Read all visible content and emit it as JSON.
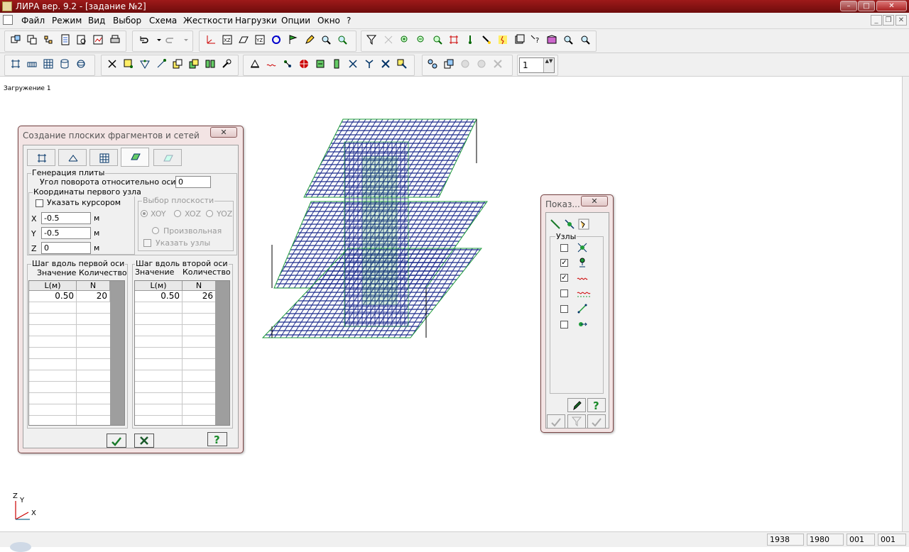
{
  "window": {
    "title": "ЛИРА  вер. 9.2 - [задание №2]",
    "min": "–",
    "max": "□",
    "close": "✕"
  },
  "menu": {
    "items": [
      "Файл",
      "Режим",
      "Вид",
      "Выбор",
      "Схема",
      "Жесткости",
      "Нагрузки",
      "Опции",
      "Окно",
      "?"
    ],
    "mdi_min": "_",
    "mdi_restore": "❐",
    "mdi_close": "✕"
  },
  "toolbar": {
    "spinner_value": "1",
    "spin_arrows": "▲▼"
  },
  "workspace": {
    "load_label": "Загружение  1"
  },
  "dialog": {
    "title": "Создание плоских фрагментов и сетей",
    "close": "✕",
    "plate_group": "Генерация плиты",
    "rotation_label": "Угол поворота относительно оси Z",
    "rotation_value": "0",
    "first_node_group": "Координаты первого узла",
    "cursor_label": "Указать курсором",
    "x_label": "X",
    "x_value": "-0.5",
    "y_label": "Y",
    "y_value": "-0.5",
    "z_label": "Z",
    "z_value": "0",
    "unit": "м",
    "plane_group": "Выбор плоскости",
    "plane_xoy": "XOY",
    "plane_xoz": "XOZ",
    "plane_yoz": "YOZ",
    "plane_arbitrary": "Произвольная",
    "plane_nodes": "Указать узлы",
    "axis1": {
      "title": "Шаг вдоль первой оси",
      "value_label": "Значение",
      "count_label": "Количество",
      "col_l": "L(м)",
      "col_n": "N",
      "rows": [
        {
          "l": "0.50",
          "n": "20"
        }
      ]
    },
    "axis2": {
      "title": "Шаг вдоль второй оси",
      "value_label": "Значение",
      "count_label": "Количество",
      "col_l": "L(м)",
      "col_n": "N",
      "rows": [
        {
          "l": "0.50",
          "n": "26"
        }
      ]
    }
  },
  "show_panel": {
    "title": "Показ...",
    "close": "✕",
    "nodes_group": "Узлы",
    "items": [
      {
        "checked": false,
        "icon": "node-icon",
        "mark": ""
      },
      {
        "checked": true,
        "icon": "support-icon",
        "mark": "✓"
      },
      {
        "checked": true,
        "icon": "node-load-icon",
        "mark": "✓"
      },
      {
        "checked": false,
        "icon": "node-load-values-icon",
        "mark": ""
      },
      {
        "checked": false,
        "icon": "rigid-insert-icon",
        "mark": ""
      },
      {
        "checked": false,
        "icon": "local-axes-icon",
        "mark": ""
      }
    ]
  },
  "status": {
    "v1": "1938",
    "v2": "1980",
    "v3": "001",
    "v4": "001"
  },
  "axis_labels": {
    "z": "Z",
    "y": "Y",
    "x": "X"
  },
  "colors": {
    "title_bar": "#8b1414",
    "dialog_frame": "#f3e4e4",
    "mesh_blue": "#1b2a8c",
    "mesh_green": "#1e9c3a"
  }
}
